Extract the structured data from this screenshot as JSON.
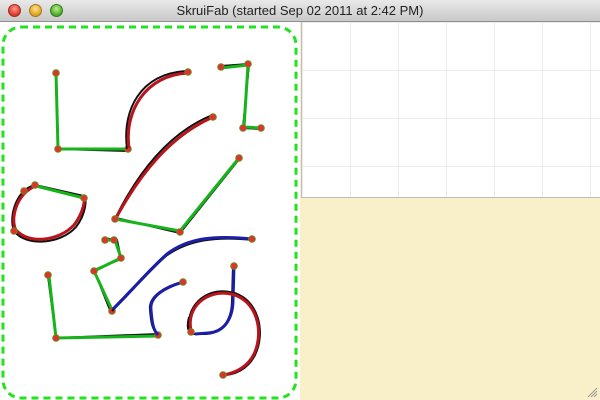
{
  "window": {
    "title": "SkruiFab (started Sep 02 2011 at 2:42 PM)"
  },
  "colors": {
    "selection_dash": "#22e31d",
    "green_stroke": "#16b41a",
    "red_stroke": "#b8141b",
    "blue_stroke": "#1c1fa6",
    "ink": "#111111",
    "node_fill": "#e23030",
    "node_stroke": "#6a8a1a",
    "panel_bg": "#f9efc9"
  },
  "icons": [
    "close-button",
    "minimize-button",
    "zoom-button",
    "resize-grip-icon"
  ]
}
